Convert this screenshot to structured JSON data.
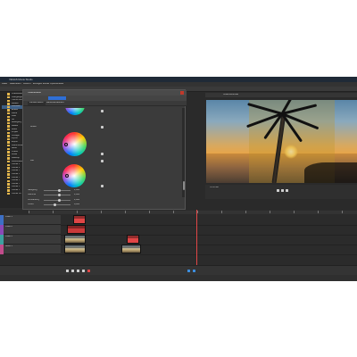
{
  "window": {
    "title": "VEGAS Movie Studio"
  },
  "menu": [
    "Datei",
    "Bearbeiten",
    "Ansicht",
    "Einfügen",
    "Extras",
    "Optionen",
    "Hilfe"
  ],
  "explorer": {
    "items": [
      "Videoeffekte",
      "Übergänge",
      "Titel & Text",
      "Medien",
      "Favoriten",
      "Effekte",
      "Farbe",
      "Filter",
      "Stil",
      "Bewegung",
      "Maske",
      "Audio",
      "Projekt",
      "Vorlagen",
      "Import",
      "Export",
      "Dokumente",
      "Bilder",
      "Videos",
      "Musik",
      "Desktop",
      "Downloads",
      "Ordner 1",
      "Ordner 2",
      "Ordner 3",
      "Ordner 4",
      "Ordner 5",
      "Ordner 6",
      "Ordner 7",
      "Ordner 8",
      "Ordner 9",
      "Ordner 10"
    ],
    "selected_index": 4
  },
  "panel": {
    "title": "Videoeffekte",
    "tabs": [
      "Farbkorrektur",
      "Benutzerdefiniert"
    ],
    "sections": [
      "Mitten",
      "Hell"
    ],
    "sliders": [
      {
        "label": "Sättigung",
        "value": "1,000",
        "level": 0.58
      },
      {
        "label": "Gamma",
        "value": "1,000",
        "level": 0.58
      },
      {
        "label": "Verstärkung",
        "value": "1,000",
        "level": 0.58
      },
      {
        "label": "Offset",
        "value": "0,000",
        "level": 0.42
      }
    ]
  },
  "preview": {
    "header": "Videovorschau",
    "label": "Vorschau"
  },
  "timeline": {
    "tracks": [
      {
        "name": "Video 1",
        "color": "#3d6fc5"
      },
      {
        "name": "Video 2",
        "color": "#8a49b5"
      },
      {
        "name": "Video 3",
        "color": "#3da0a0"
      },
      {
        "name": "Audio 1",
        "color": "#c14c8b"
      }
    ]
  },
  "colors": {
    "accent": "#2f6fd6",
    "clip_red": "#e04646"
  },
  "icons": [
    "folder-icon",
    "play-icon",
    "stop-icon",
    "pause-icon",
    "record-icon"
  ]
}
